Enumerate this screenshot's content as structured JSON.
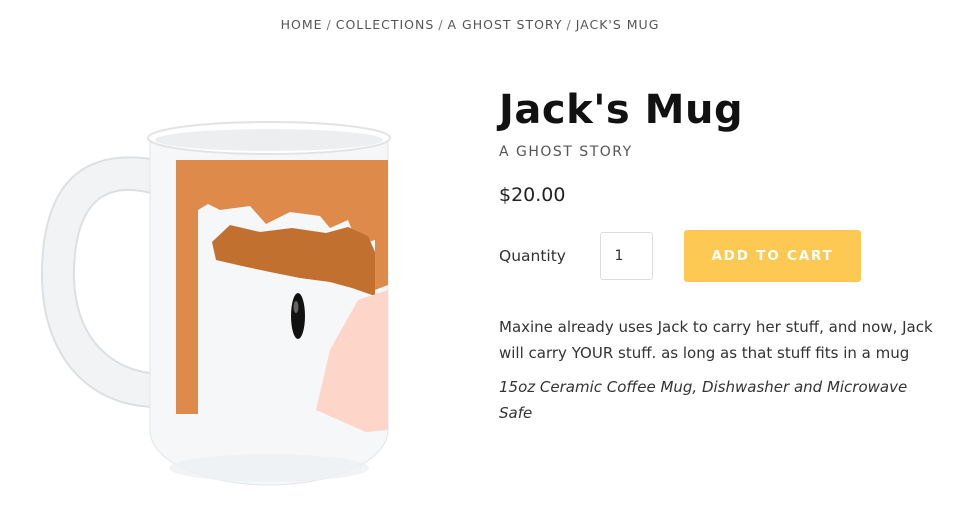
{
  "breadcrumb": {
    "home": "HOME",
    "collections": "COLLECTIONS",
    "collection": "A GHOST STORY",
    "current": "JACK'S MUG",
    "separator": "/"
  },
  "product": {
    "title": "Jack's Mug",
    "vendor": "A GHOST STORY",
    "price": "$20.00",
    "quantity_label": "Quantity",
    "quantity_value": "1",
    "add_to_cart_label": "ADD TO CART",
    "description": "Maxine already uses Jack to carry her stuff, and now, Jack will carry YOUR stuff. as long as that stuff fits in a mug",
    "specs": "15oz Ceramic Coffee Mug, Dishwasher and Microwave Safe"
  },
  "colors": {
    "button": "#fec953",
    "hair_light": "#dd8a4b",
    "hair_dark": "#c2702f",
    "skin": "#fdd5c9"
  }
}
